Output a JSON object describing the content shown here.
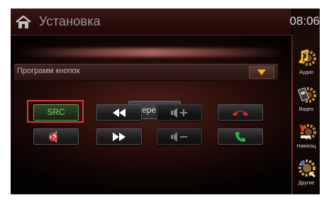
{
  "header": {
    "title": "Установка",
    "time": "08:06"
  },
  "dropdown": {
    "label": "Программ кнопок"
  },
  "reprogram_button": "Перепрог",
  "buttons": {
    "src_label": "SRC"
  },
  "sidebar": {
    "items": [
      {
        "label": "Аудио",
        "icon": "music-note-gear-icon"
      },
      {
        "label": "Видео",
        "icon": "film-gear-icon"
      },
      {
        "label": "Навигац",
        "icon": "navigation-gear-icon"
      },
      {
        "label": "Другие",
        "icon": "other-gear-icon"
      }
    ]
  },
  "colors": {
    "accent_selection": "#d93a43",
    "src_text": "#8ed15c",
    "dropdown_arrow": "#f1b21d",
    "hangup_red": "#d8262a",
    "call_green": "#2fb34a"
  }
}
